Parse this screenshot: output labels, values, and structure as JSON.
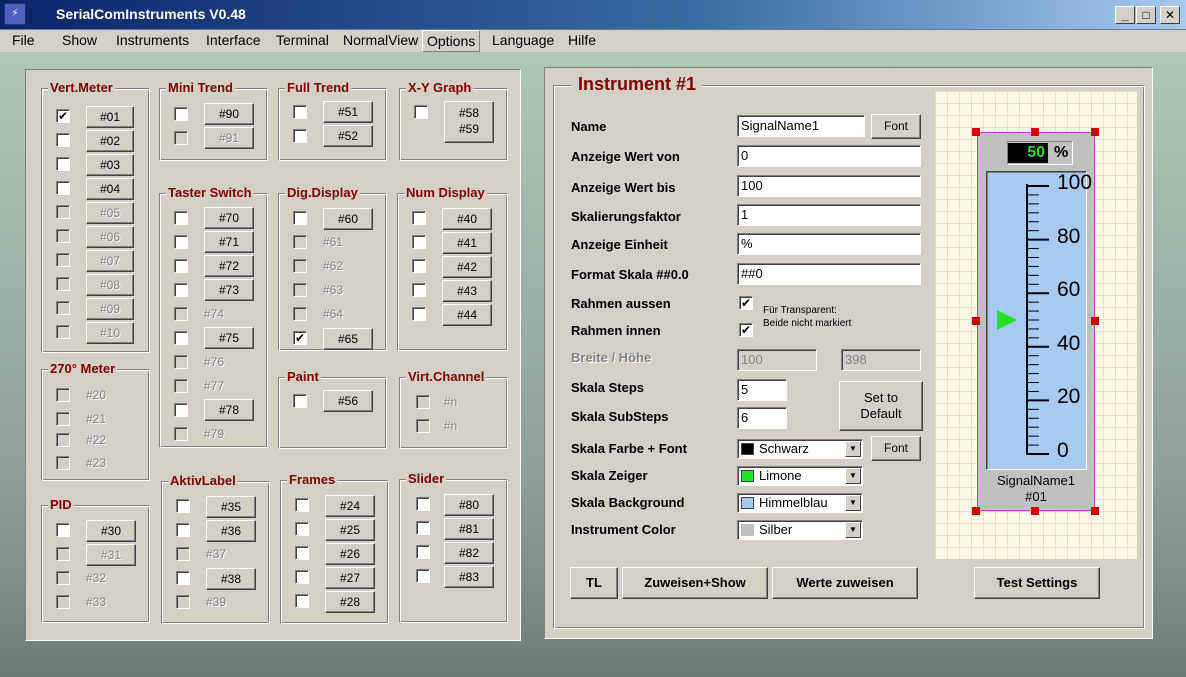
{
  "app": {
    "title": "SerialComInstruments  V0.48",
    "icon": "app-icon"
  },
  "window_controls": {
    "minimize": "_",
    "maximize": "□",
    "close": "✕"
  },
  "menu": [
    "File",
    "Show",
    "Instruments",
    "Interface",
    "Terminal",
    "NormalView",
    "Options",
    "Language",
    "Hilfe"
  ],
  "groups": {
    "vert_meter": {
      "title": "Vert.Meter",
      "items": [
        "#01",
        "#02",
        "#03",
        "#04",
        "#05",
        "#06",
        "#07",
        "#08",
        "#09",
        "#10"
      ]
    },
    "mini_trend": {
      "title": "Mini Trend",
      "items": [
        "#90",
        "#91"
      ]
    },
    "full_trend": {
      "title": "Full Trend",
      "items": [
        "#51",
        "#52"
      ]
    },
    "xy_graph": {
      "title": "X-Y Graph",
      "items": [
        "#58",
        "#59"
      ]
    },
    "taster_switch": {
      "title": "Taster Switch",
      "items": [
        "#70",
        "#71",
        "#72",
        "#73",
        "#74",
        "#75",
        "#76",
        "#77",
        "#78",
        "#79"
      ]
    },
    "dig_display": {
      "title": "Dig.Display",
      "items": [
        "#60",
        "#61",
        "#62",
        "#63",
        "#64",
        "#65"
      ]
    },
    "num_display": {
      "title": "Num Display",
      "items": [
        "#40",
        "#41",
        "#42",
        "#43",
        "#44"
      ]
    },
    "meter_270": {
      "title": "270° Meter",
      "items": [
        "#20",
        "#21",
        "#22",
        "#23"
      ]
    },
    "paint": {
      "title": "Paint",
      "items": [
        "#56"
      ]
    },
    "virt_channel": {
      "title": "Virt.Channel",
      "items": [
        "#n",
        "#n"
      ]
    },
    "pid": {
      "title": "PID",
      "items": [
        "#30",
        "#31",
        "#32",
        "#33"
      ]
    },
    "aktiv_label": {
      "title": "AktivLabel",
      "items": [
        "#35",
        "#36",
        "#37",
        "#38",
        "#39"
      ]
    },
    "frames": {
      "title": "Frames",
      "items": [
        "#24",
        "#25",
        "#26",
        "#27",
        "#28"
      ]
    },
    "slider": {
      "title": "Slider",
      "items": [
        "#80",
        "#81",
        "#82",
        "#83"
      ]
    }
  },
  "instrument": {
    "title": "Instrument #1",
    "labels": {
      "name": "Name",
      "wert_von": "Anzeige Wert von",
      "wert_bis": "Anzeige Wert bis",
      "skalierung": "Skalierungsfaktor",
      "einheit": "Anzeige Einheit",
      "format": "Format Skala ##0.0",
      "rahmen_aussen": "Rahmen aussen",
      "rahmen_innen": "Rahmen innen",
      "breite_hoehe": "Breite  / Höhe",
      "steps": "Skala Steps",
      "substeps": "Skala SubSteps",
      "farbe_font": "Skala Farbe + Font",
      "zeiger": "Skala Zeiger",
      "background": "Skala Background",
      "instr_color": "Instrument Color"
    },
    "values": {
      "name": "SignalName1",
      "wert_von": "0",
      "wert_bis": "100",
      "skalierung": "1",
      "einheit": "%",
      "format": "##0",
      "breite": "100",
      "hoehe": "398",
      "steps": "5",
      "substeps": "6"
    },
    "transparent_note": {
      "line1": "Für Transparent:",
      "line2": "Beide nicht markiert"
    },
    "combos": {
      "farbe": {
        "text": "Schwarz",
        "color": "#000000"
      },
      "zeiger": {
        "text": "Limone",
        "color": "#22e022"
      },
      "background": {
        "text": "Himmelblau",
        "color": "#a6caf0"
      },
      "instr_color": {
        "text": "Silber",
        "color": "#c0c0c0"
      }
    },
    "buttons": {
      "font": "Font",
      "set_default_1": "Set to",
      "set_default_2": "Default",
      "tl": "TL",
      "zuweisen_show": "Zuweisen+Show",
      "werte_zuweisen": "Werte zuweisen",
      "test_settings": "Test Settings"
    }
  },
  "preview": {
    "value_display": "50",
    "unit": "%",
    "scale": {
      "min": 0,
      "max": 100,
      "labels": [
        "100",
        "80",
        "60",
        "40",
        "20",
        "0"
      ]
    },
    "pointer_value": 50,
    "signal_name": "SignalName1",
    "instrument_id": "#01"
  }
}
